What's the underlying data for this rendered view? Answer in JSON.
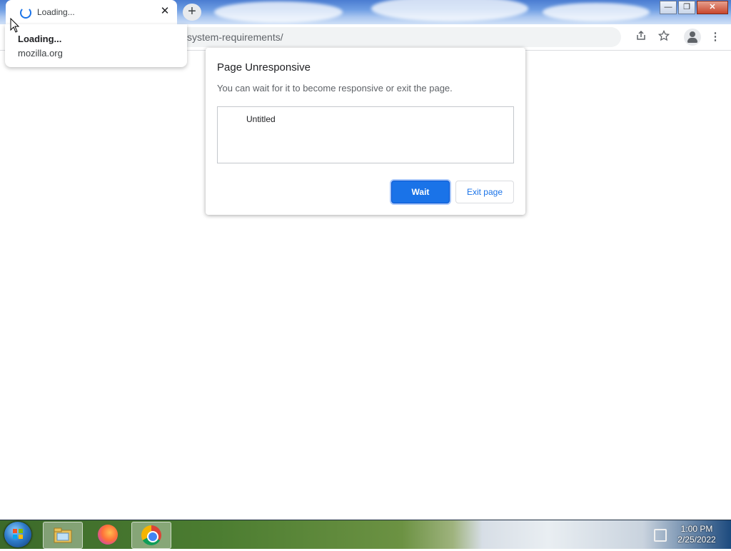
{
  "tab": {
    "title": "Loading...",
    "close": "✕"
  },
  "new_tab": {
    "label": "+"
  },
  "window_controls": {
    "minimize": "—",
    "restore": "❐",
    "close": "✕"
  },
  "hover_card": {
    "title": "Loading...",
    "domain": "mozilla.org"
  },
  "toolbar": {
    "url": "system-requirements/"
  },
  "dialog": {
    "title": "Page Unresponsive",
    "message": "You can wait for it to become responsive or exit the page.",
    "pages": [
      "Untitled"
    ],
    "wait_label": "Wait",
    "exit_label": "Exit page"
  },
  "taskbar": {
    "time": "1:00 PM",
    "date": "2/25/2022"
  },
  "colors": {
    "accent": "#1a73e8"
  }
}
